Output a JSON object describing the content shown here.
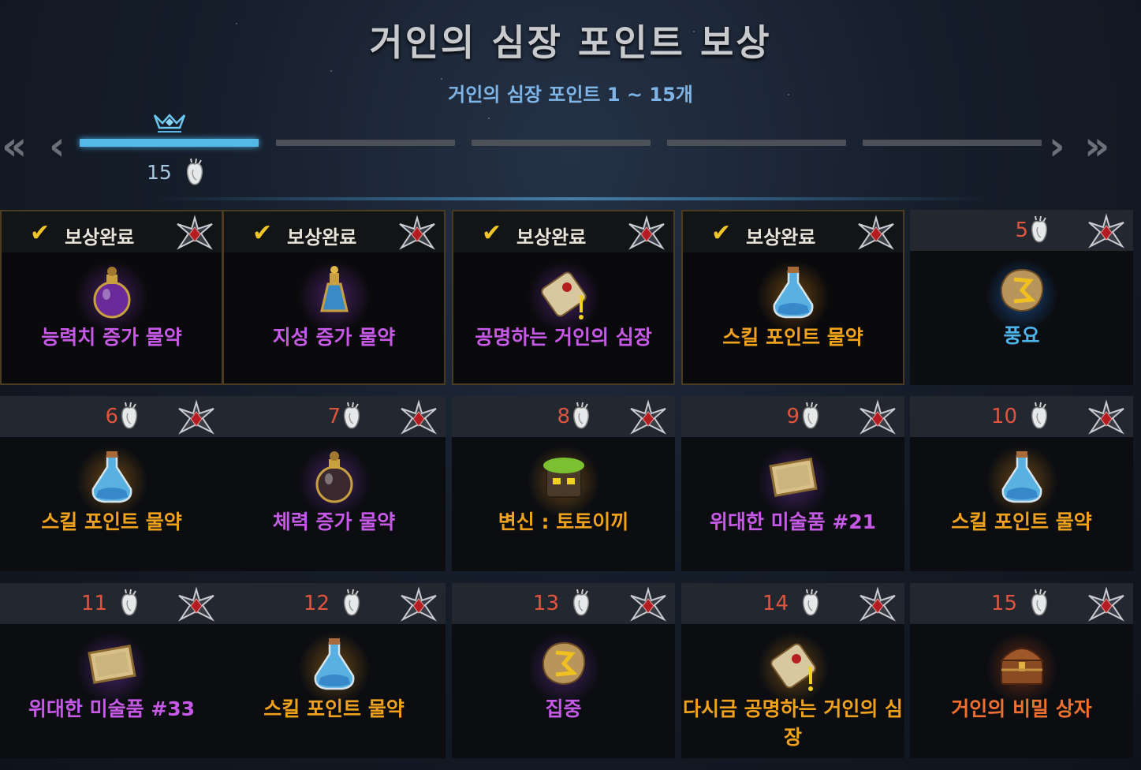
{
  "header": {
    "title": "거인의 심장 포인트 보상",
    "subtitle": "거인의 심장 포인트 1 ~ 15개",
    "progress_value": "15",
    "nav_first": "«",
    "nav_prev": "‹",
    "nav_next": "›",
    "nav_last": "»",
    "active_page": 1,
    "total_pages": 5
  },
  "colors": {
    "purple": "#c65ae6",
    "orange": "#f0a21c",
    "blue": "#4fb4ea",
    "red": "#f07030",
    "accent": "#54b8e8",
    "level": "#e0553f"
  },
  "rewards": [
    {
      "level": "",
      "claimed": true,
      "status": "보상완료",
      "name": "능력치 증가 물약",
      "grade": "purple",
      "icon": "potion-round-purple-icon"
    },
    {
      "level": "",
      "claimed": true,
      "status": "보상완료",
      "name": "지성 증가 물약",
      "grade": "purple",
      "icon": "potion-tall-blue-icon"
    },
    {
      "level": "",
      "claimed": true,
      "status": "보상완료",
      "name": "공명하는 거인의 심장",
      "grade": "purple",
      "icon": "scroll-icon"
    },
    {
      "level": "",
      "claimed": true,
      "status": "보상완료",
      "name": "스킬 포인트 물약",
      "grade": "orange",
      "icon": "potion-flask-blue-icon"
    },
    {
      "level": "5",
      "claimed": false,
      "status": "",
      "name": "풍요",
      "grade": "blue",
      "icon": "rune-icon"
    },
    {
      "level": "6",
      "claimed": false,
      "status": "",
      "name": "스킬 포인트 물약",
      "grade": "orange",
      "icon": "potion-flask-blue-icon"
    },
    {
      "level": "7",
      "claimed": false,
      "status": "",
      "name": "체력 증가 물약",
      "grade": "purple",
      "icon": "potion-round-dark-icon"
    },
    {
      "level": "8",
      "claimed": false,
      "status": "",
      "name": "변신 : 토토이끼",
      "grade": "orange",
      "icon": "mossy-chest-icon"
    },
    {
      "level": "9",
      "claimed": false,
      "status": "",
      "name": "위대한 미술품 #21",
      "grade": "purple",
      "icon": "painting-icon"
    },
    {
      "level": "10",
      "claimed": false,
      "status": "",
      "name": "스킬 포인트 물약",
      "grade": "orange",
      "icon": "potion-flask-blue-icon"
    },
    {
      "level": "11",
      "claimed": false,
      "status": "",
      "name": "위대한 미술품 #33",
      "grade": "purple",
      "icon": "painting-icon"
    },
    {
      "level": "12",
      "claimed": false,
      "status": "",
      "name": "스킬 포인트 물약",
      "grade": "orange",
      "icon": "potion-flask-blue-icon"
    },
    {
      "level": "13",
      "claimed": false,
      "status": "",
      "name": "집중",
      "grade": "purple",
      "icon": "rune-icon"
    },
    {
      "level": "14",
      "claimed": false,
      "status": "",
      "name": "다시금 공명하는 거인의 심장",
      "grade": "orange",
      "icon": "scroll-icon"
    },
    {
      "level": "15",
      "claimed": false,
      "status": "",
      "name": "거인의 비밀 상자",
      "grade": "red",
      "icon": "treasure-chest-icon"
    }
  ]
}
